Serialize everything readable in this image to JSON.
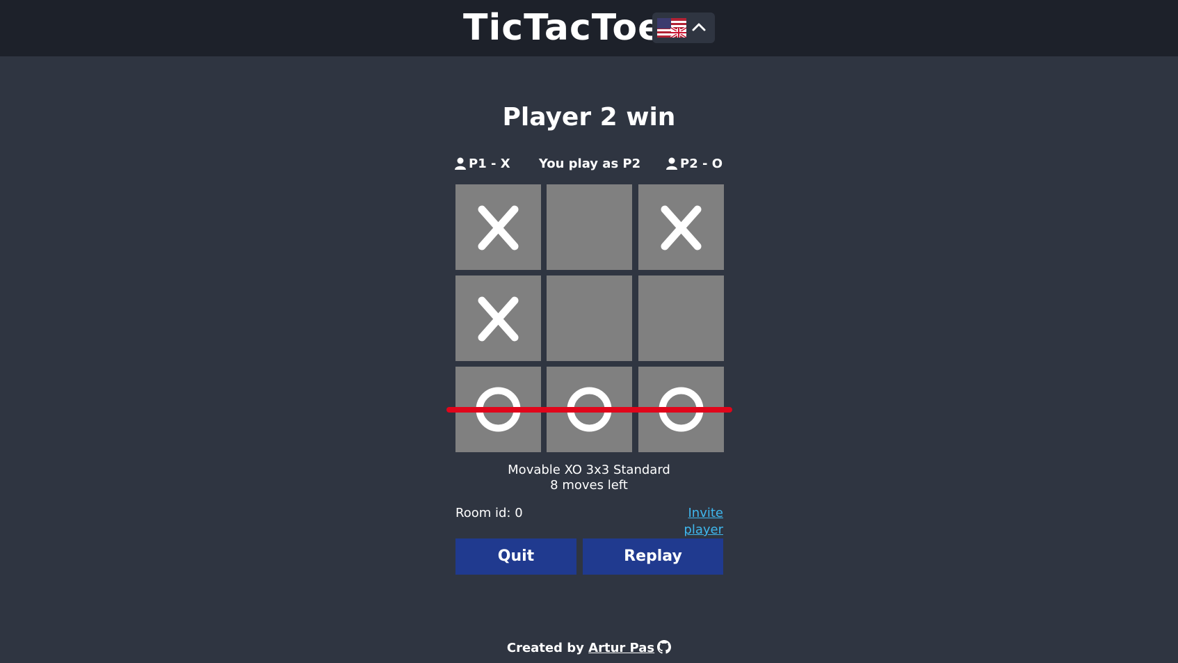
{
  "header": {
    "title": "TicTacToe",
    "language_flag": "uk-us-flag-icon",
    "language_toggle": "chevron-up-icon"
  },
  "status": "Player 2 win",
  "players": {
    "p1": "P1 - X",
    "you": "You play as P2",
    "p2": "P2 - O"
  },
  "board": [
    [
      "X",
      "",
      "X"
    ],
    [
      "X",
      "",
      ""
    ],
    [
      "O",
      "O",
      "O"
    ]
  ],
  "winning_line": {
    "row": 3,
    "color": "#e0061b"
  },
  "game_info": {
    "mode": "Movable XO 3x3 Standard",
    "moves_left": "8 moves left"
  },
  "room": {
    "label": "Room id: 0",
    "invite": "Invite player"
  },
  "buttons": {
    "quit": "Quit",
    "replay": "Replay"
  },
  "footer": {
    "prefix": "Created by",
    "author": "Artur Pas",
    "icon": "github-icon"
  },
  "colors": {
    "background": "#2f3541",
    "header": "#1d212a",
    "cell": "#808080",
    "button": "#203a8f",
    "link": "#3fb8ef"
  }
}
